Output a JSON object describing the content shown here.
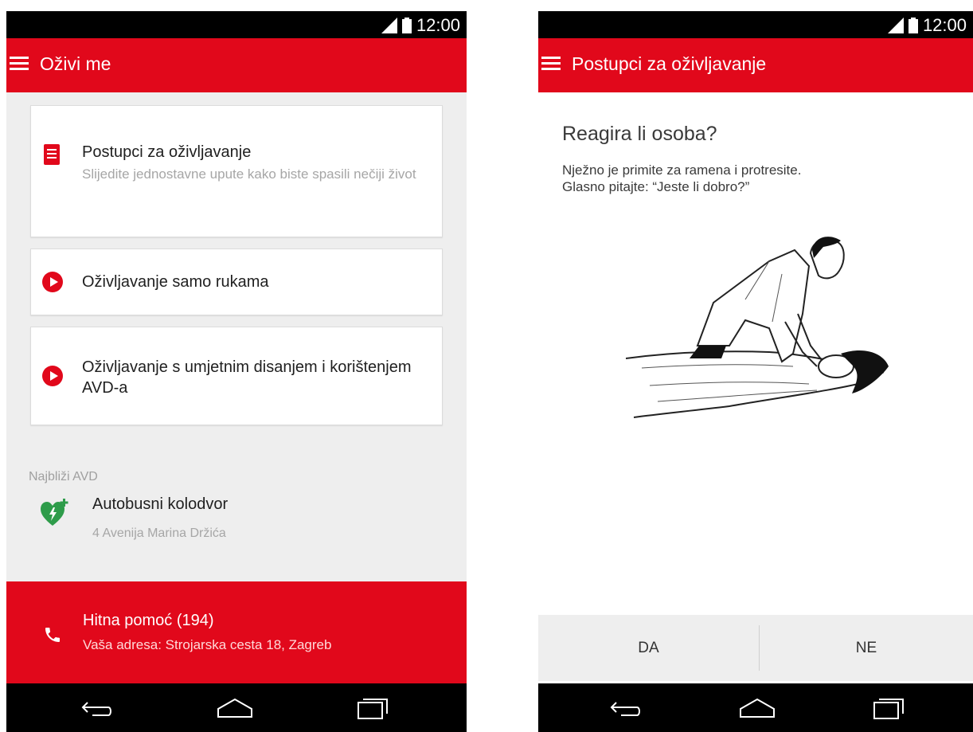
{
  "colors": {
    "accent": "#e1081b",
    "aed_green": "#2e9c4a"
  },
  "left_screen": {
    "status_time": "12:00",
    "app_title": "Oživi me",
    "cards": [
      {
        "title": "Postupci za oživljavanje",
        "subtitle": "Slijedite jednostavne upute kako biste spasili nečiji život",
        "icon": "document-icon"
      },
      {
        "title": "Oživljavanje samo rukama",
        "icon": "play-icon"
      },
      {
        "title": "Oživljavanje s umjetnim disanjem i korištenjem AVD-a",
        "icon": "play-icon"
      }
    ],
    "aed": {
      "label": "Najbliži AVD",
      "name": "Autobusni kolodvor",
      "address": "4 Avenija Marina Držića",
      "icon": "aed-heart-icon"
    },
    "emergency": {
      "title": "Hitna pomoć (194)",
      "address": "Vaša adresa: Strojarska cesta 18, Zagreb",
      "icon": "phone-icon"
    }
  },
  "right_screen": {
    "status_time": "12:00",
    "app_title": "Postupci za oživljavanje",
    "question": "Reagira li osoba?",
    "instructions": "Nježno je primite za ramena i protresite.\nGlasno pitajte: “Jeste li dobro?”",
    "buttons": {
      "yes": "DA",
      "no": "NE"
    }
  }
}
